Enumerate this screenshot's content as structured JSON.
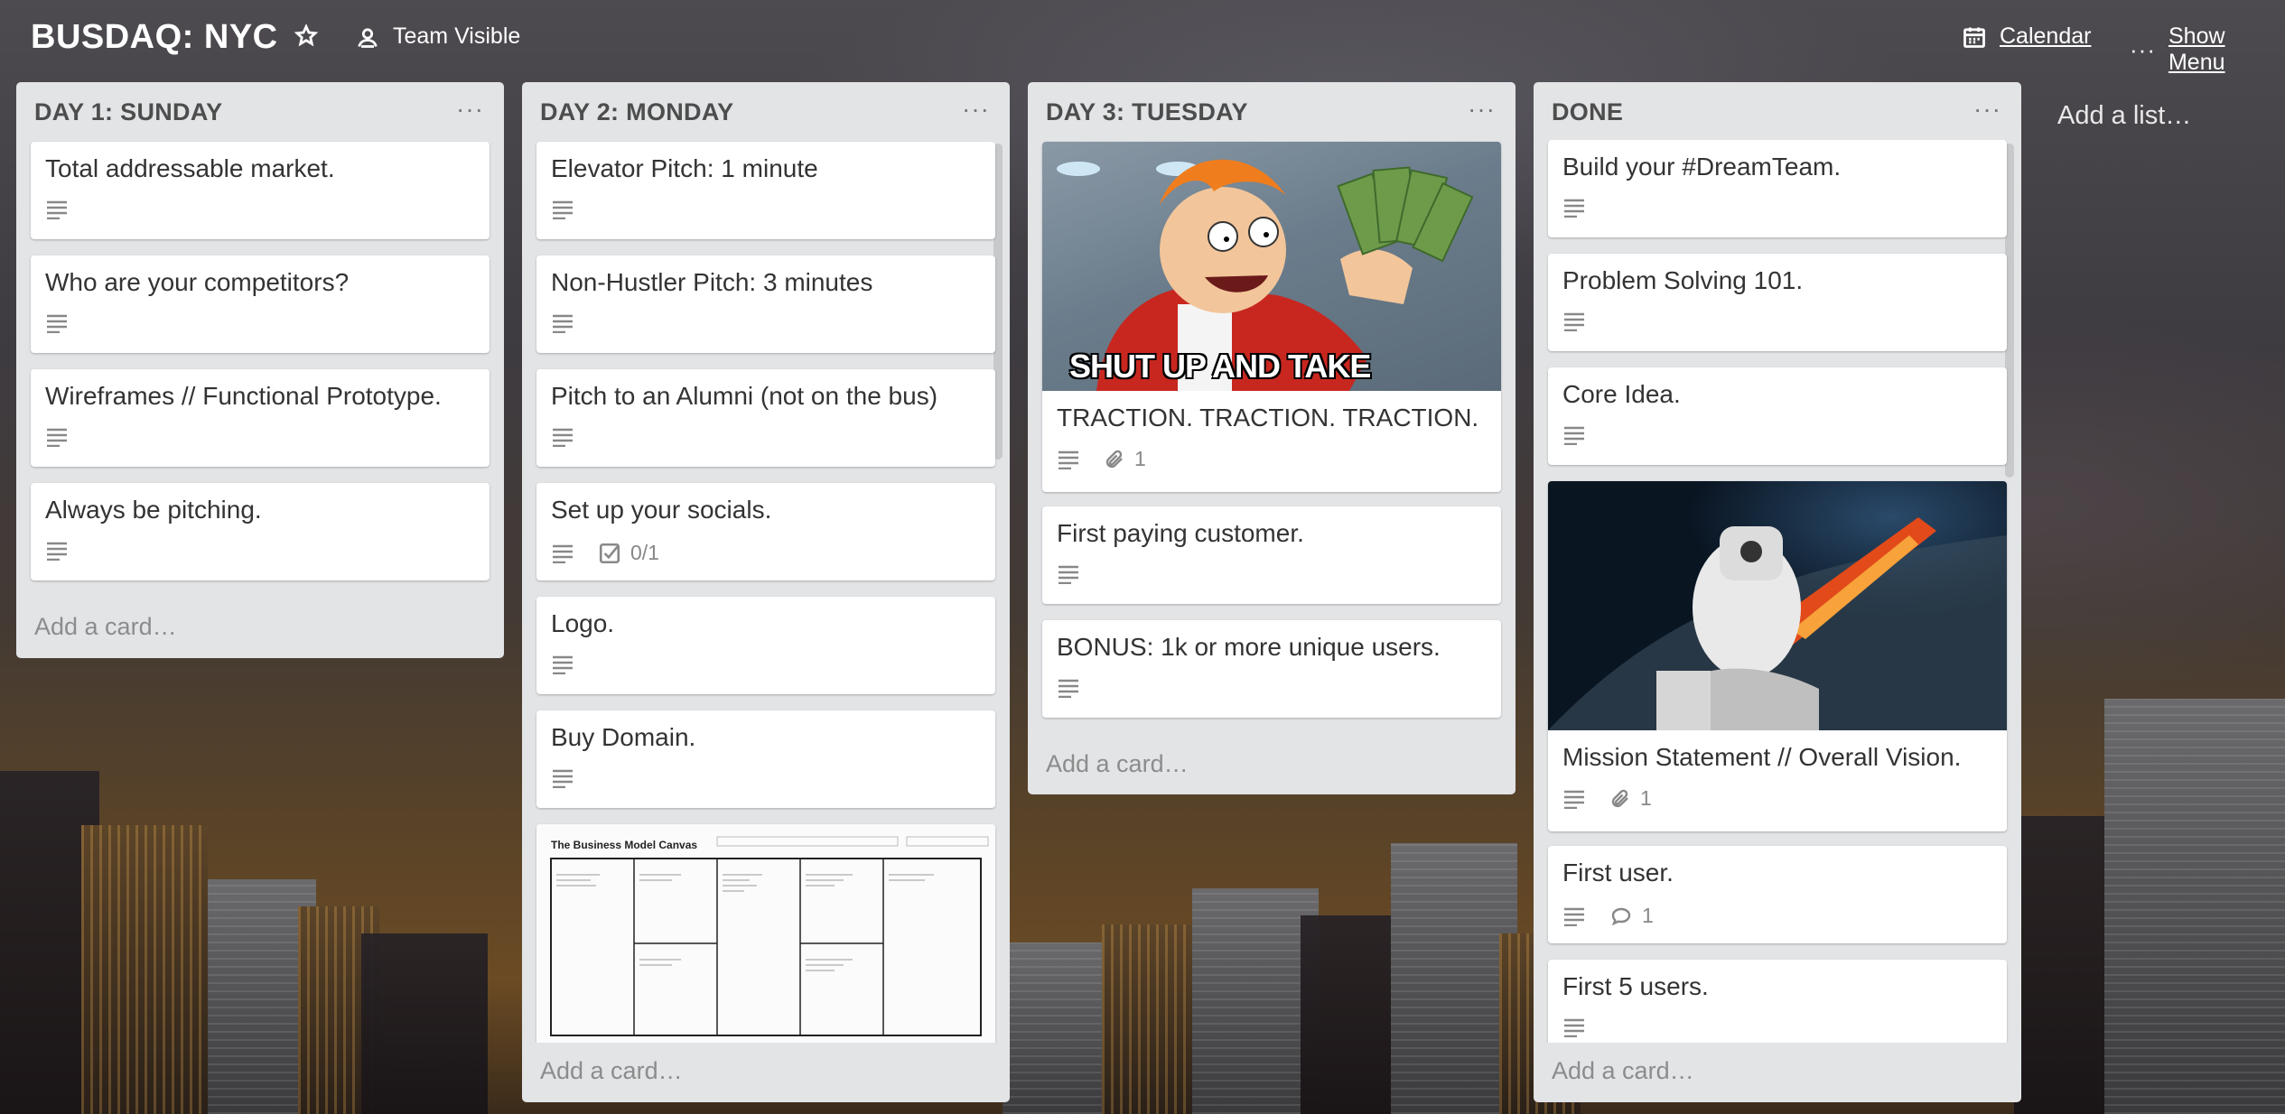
{
  "board": {
    "title": "BUSDAQ: NYC",
    "visibility": "Team Visible",
    "calendar": "Calendar",
    "show_menu": "Show Menu",
    "add_list": "Add a list…"
  },
  "colors": {
    "list_bg": "#e2e4e6",
    "card_bg": "#ffffff",
    "title_text": "#4d4d4d",
    "muted_text": "#8c8c8c"
  },
  "add_card_label": "Add a card…",
  "list_menu_glyph": "···",
  "lists": [
    {
      "title": "DAY 1: SUNDAY",
      "cards": [
        {
          "title": "Total addressable market."
        },
        {
          "title": "Who are your competitors?"
        },
        {
          "title": "Wireframes // Functional Prototype."
        },
        {
          "title": "Always be pitching."
        }
      ]
    },
    {
      "title": "DAY 2: MONDAY",
      "cards": [
        {
          "title": "Elevator Pitch: 1 minute"
        },
        {
          "title": "Non-Hustler Pitch: 3 minutes"
        },
        {
          "title": "Pitch to an Alumni (not on the bus)"
        },
        {
          "title": "Set up your socials.",
          "checklist": "0/1"
        },
        {
          "title": "Logo."
        },
        {
          "title": "Buy Domain."
        },
        {
          "title": "",
          "cover": "The Business Model Canvas"
        }
      ]
    },
    {
      "title": "DAY 3: TUESDAY",
      "cards": [
        {
          "title": "TRACTION. TRACTION. TRACTION.",
          "attachments": "1",
          "cover_caption": "SHUT UP AND TAKE"
        },
        {
          "title": "First paying customer."
        },
        {
          "title": "BONUS: 1k or more unique users."
        }
      ]
    },
    {
      "title": "DONE",
      "cards": [
        {
          "title": "Build your #DreamTeam."
        },
        {
          "title": "Problem Solving 101."
        },
        {
          "title": "Core Idea."
        },
        {
          "title": "Mission Statement // Overall Vision.",
          "attachments": "1"
        },
        {
          "title": "First user.",
          "comments": "1"
        },
        {
          "title": "First 5 users."
        }
      ]
    }
  ],
  "icons": {
    "star": "star-icon",
    "visibility": "team-icon",
    "calendar": "calendar-icon",
    "menu": "more-icon",
    "description": "description-icon",
    "checklist": "checklist-icon",
    "attachment": "paperclip-icon",
    "comment": "comment-icon"
  }
}
